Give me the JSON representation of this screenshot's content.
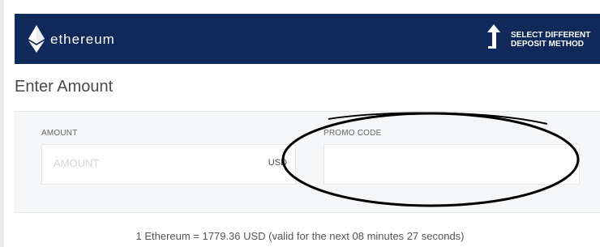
{
  "header": {
    "brand": "ethereum",
    "switch_line1": "SELECT DIFFERENT",
    "switch_line2": "DEPOSIT METHOD"
  },
  "page": {
    "title": "Enter Amount"
  },
  "form": {
    "amount": {
      "label": "AMOUNT",
      "placeholder": "AMOUNT",
      "value": "",
      "currency": "USD"
    },
    "promo": {
      "label": "PROMO CODE",
      "value": ""
    }
  },
  "rate_text": "1 Ethereum = 1779.36 USD  (valid for the next 08 minutes 27 seconds)",
  "colors": {
    "header_bg": "#0f2a5a",
    "panel_bg": "#f5f6f7",
    "annotation": "#000000"
  },
  "icons": [
    "ethereum-logo-icon",
    "arrow-up-icon"
  ]
}
